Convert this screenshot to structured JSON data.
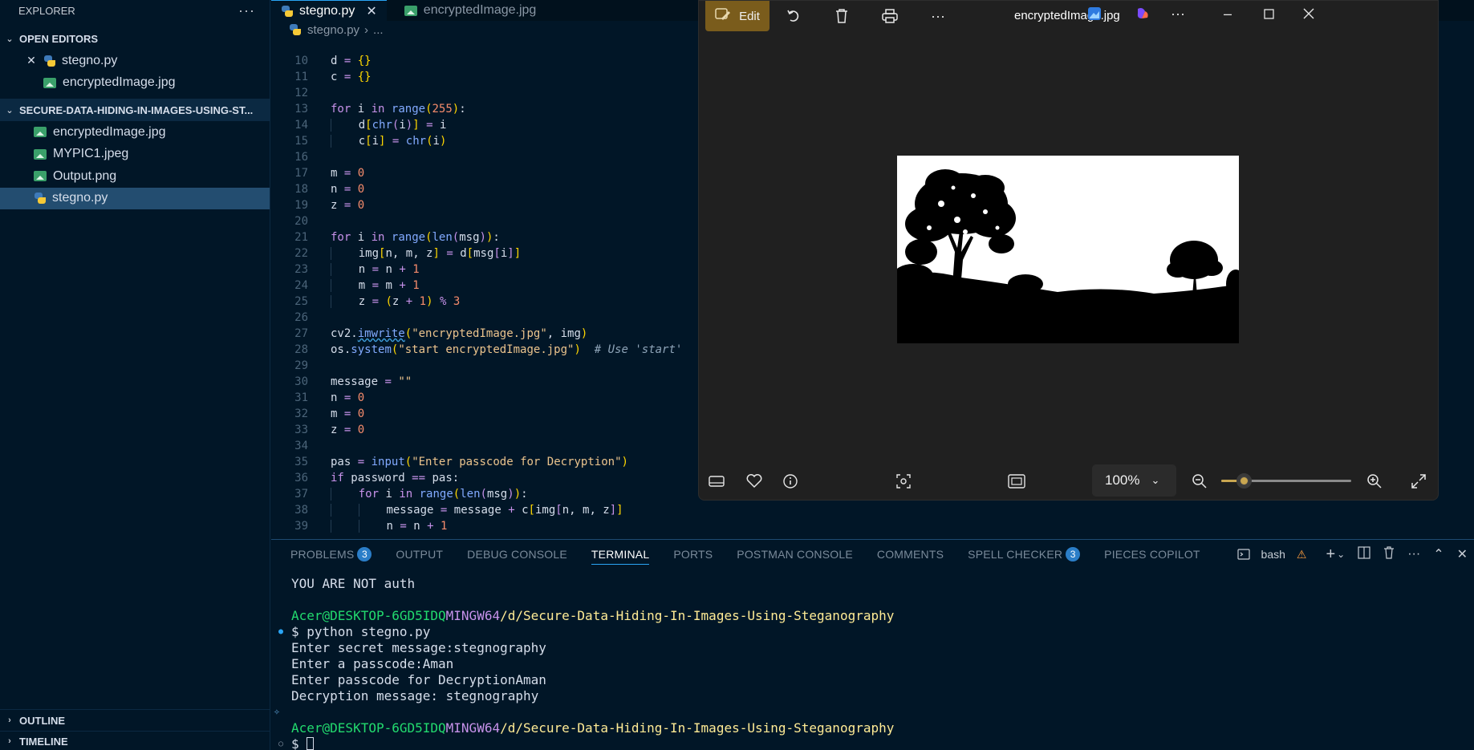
{
  "sidebar": {
    "title": "EXPLORER",
    "more": "···",
    "open_editors": {
      "label": "OPEN EDITORS",
      "items": [
        {
          "label": "stegno.py",
          "close": "✕"
        },
        {
          "label": "encryptedImage.jpg"
        }
      ]
    },
    "project": {
      "label": "SECURE-DATA-HIDING-IN-IMAGES-USING-ST...",
      "files": [
        {
          "label": "encryptedImage.jpg"
        },
        {
          "label": "MYPIC1.jpeg"
        },
        {
          "label": "Output.png"
        },
        {
          "label": "stegno.py"
        }
      ]
    },
    "outline": "OUTLINE",
    "timeline": "TIMELINE"
  },
  "editor": {
    "tabs": [
      {
        "label": "stegno.py",
        "close": "✕"
      },
      {
        "label": "encryptedImage.jpg"
      }
    ],
    "breadcrumb": {
      "file": "stegno.py",
      "sep": "›",
      "rest": "..."
    },
    "line_numbers": [
      "10",
      "11",
      "12",
      "13",
      "14",
      "15",
      "16",
      "17",
      "18",
      "19",
      "20",
      "21",
      "22",
      "23",
      "24",
      "25",
      "26",
      "27",
      "28",
      "29",
      "30",
      "31",
      "32",
      "33",
      "34",
      "35",
      "36",
      "37",
      "38",
      "39"
    ]
  },
  "viewer": {
    "edit_label": "Edit",
    "title": "encryptedImage.jpg",
    "zoom": "100%",
    "zoom_level": 0.17
  },
  "panel": {
    "tabs": [
      {
        "label": "PROBLEMS",
        "badge": "3"
      },
      {
        "label": "OUTPUT"
      },
      {
        "label": "DEBUG CONSOLE"
      },
      {
        "label": "TERMINAL"
      },
      {
        "label": "PORTS"
      },
      {
        "label": "POSTMAN CONSOLE"
      },
      {
        "label": "COMMENTS"
      },
      {
        "label": "SPELL CHECKER",
        "badge": "3"
      },
      {
        "label": "PIECES COPILOT"
      }
    ],
    "shell": "bash",
    "terminal": {
      "line1": "YOU ARE NOT auth",
      "prompt_user": "Acer@DESKTOP-6GD5IDQ",
      "prompt_env": "MINGW64",
      "prompt_path": "/d/Secure-Data-Hiding-In-Images-Using-Steganography",
      "command": "$ python stegno.py",
      "out1": "Enter secret message:stegnography",
      "out2": "Enter a passcode:Aman",
      "out3": "Enter passcode for DecryptionAman",
      "out4": "Decryption message: stegnography",
      "prompt_symbol": "$ "
    }
  },
  "colors": {
    "background": "#011627",
    "accent": "#2aa4f4",
    "edit_button": "#7a5c1c",
    "prompt_green": "#22da6e",
    "prompt_pink": "#c792ea",
    "prompt_yellow": "#ffeb95"
  }
}
